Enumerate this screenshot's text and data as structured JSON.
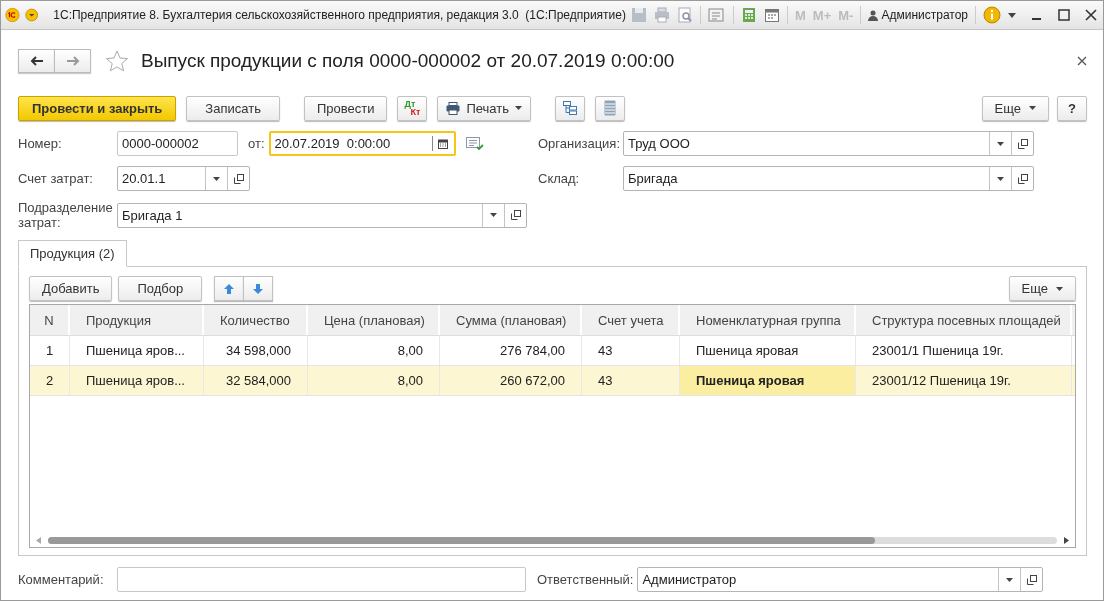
{
  "window": {
    "title": "1С:Предприятие 8. Бухгалтерия сельскохозяйственного предприятия, редакция 3.0  (1С:Предприятие)",
    "memory_buttons": [
      {
        "label": "M",
        "disabled": true
      },
      {
        "label": "M+",
        "disabled": true
      },
      {
        "label": "M-",
        "disabled": true
      }
    ],
    "user": "Администратор"
  },
  "document": {
    "title": "Выпуск продукции с поля 0000-000002 от 20.07.2019 0:00:00",
    "favorite": false
  },
  "command_bar": {
    "buttons": [
      {
        "kind": "primary",
        "label": "Провести и закрыть"
      },
      {
        "kind": "text",
        "label": "Записать"
      },
      {
        "kind": "text",
        "label": "Провести"
      },
      {
        "kind": "dtkt",
        "labels": [
          "Дт",
          "Кт"
        ]
      },
      {
        "kind": "print",
        "label": "Печать"
      },
      {
        "kind": "structure"
      },
      {
        "kind": "list"
      }
    ],
    "more": "Еще",
    "help": "?"
  },
  "form": {
    "number": {
      "label": "Номер:",
      "value": "0000-000002"
    },
    "date": {
      "label": "от:",
      "value": "20.07.2019  0:00:00",
      "focused": true
    },
    "left": [
      {
        "label": "Счет затрат:",
        "value": "20.01.1",
        "dropdown": true,
        "open_button": true
      },
      {
        "label": "Подразделение затрат:",
        "value": "Бригада 1",
        "dropdown": true,
        "open_button": true
      }
    ],
    "right": [
      {
        "label": "Организация:",
        "value": "Труд ООО",
        "dropdown": true,
        "open_button": true
      },
      {
        "label": "Склад:",
        "value": "Бригада",
        "dropdown": true,
        "open_button": true
      }
    ]
  },
  "tabs": [
    {
      "label": "Продукция (2)",
      "selected": true
    }
  ],
  "table_toolbar": {
    "buttons": [
      "Добавить",
      "Подбор"
    ],
    "more": "Еще"
  },
  "table": {
    "columns": [
      "N",
      "Продукция",
      "Количество",
      "Цена (плановая)",
      "Сумма (плановая)",
      "Счет учета",
      "Номенклатурная группа",
      "Структура посевных площадей"
    ],
    "rows": [
      {
        "selected": false,
        "cells": [
          {
            "text": "1",
            "current": false
          },
          {
            "text": "Пшеница яров...",
            "current": false
          },
          {
            "text": "34 598,000",
            "current": false
          },
          {
            "text": "8,00",
            "current": false
          },
          {
            "text": "276 784,00",
            "current": false
          },
          {
            "text": "43",
            "current": false
          },
          {
            "text": "Пшеница яровая",
            "current": false
          },
          {
            "text": "23001/1 Пшеница 19г.",
            "current": false
          }
        ]
      },
      {
        "selected": true,
        "cells": [
          {
            "text": "2",
            "current": false
          },
          {
            "text": "Пшеница яров...",
            "current": false
          },
          {
            "text": "32 584,000",
            "current": false
          },
          {
            "text": "8,00",
            "current": false
          },
          {
            "text": "260 672,00",
            "current": false
          },
          {
            "text": "43",
            "current": false
          },
          {
            "text": "Пшеница яровая",
            "current": true
          },
          {
            "text": "23001/12 Пшеница 19г.",
            "current": false
          }
        ]
      }
    ]
  },
  "footer": {
    "comment": {
      "label": "Комментарий:"
    },
    "responsible": {
      "label": "Ответственный:",
      "value": "Администратор",
      "dropdown": true,
      "open_button": true
    }
  }
}
